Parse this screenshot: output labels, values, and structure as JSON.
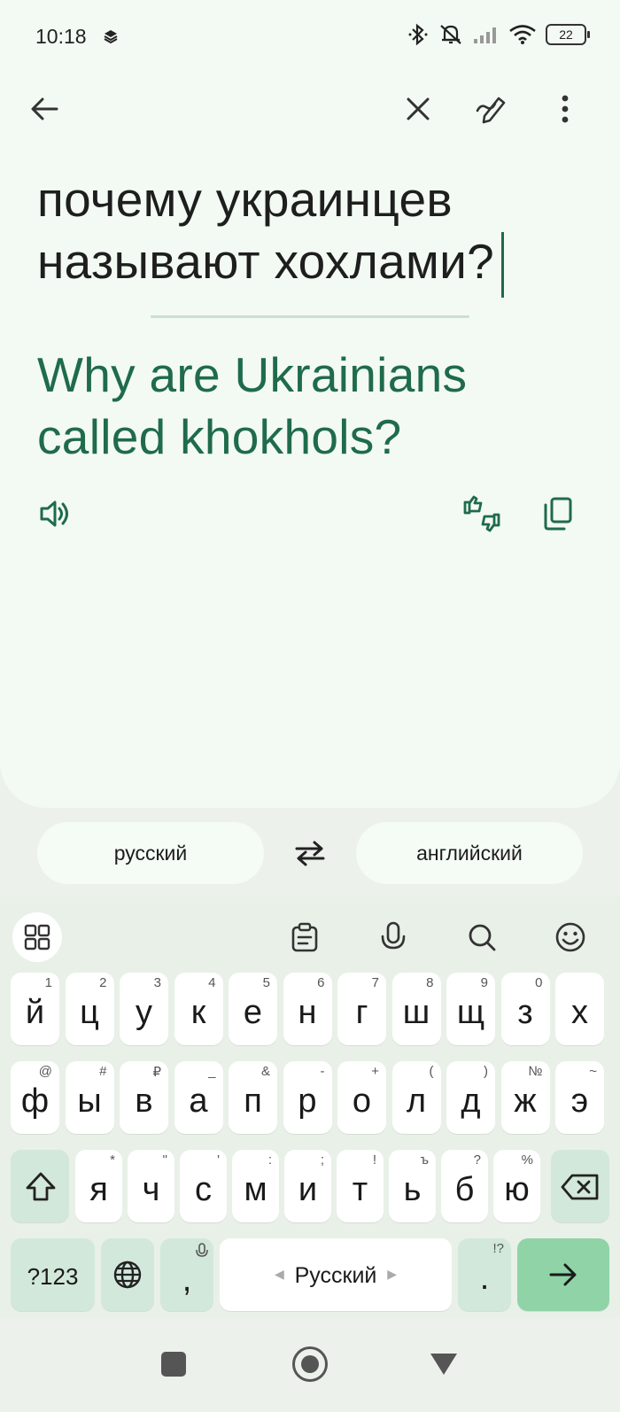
{
  "status_bar": {
    "time": "10:18",
    "battery": "22"
  },
  "source_text": "почему украинцев называют хохлами?",
  "translated_text": "Why are Ukrainians called khokhols?",
  "languages": {
    "source": "русский",
    "target": "английский"
  },
  "keyboard": {
    "row1": [
      {
        "hint": "1",
        "key": "й"
      },
      {
        "hint": "2",
        "key": "ц"
      },
      {
        "hint": "3",
        "key": "у"
      },
      {
        "hint": "4",
        "key": "к"
      },
      {
        "hint": "5",
        "key": "е"
      },
      {
        "hint": "6",
        "key": "н"
      },
      {
        "hint": "7",
        "key": "г"
      },
      {
        "hint": "8",
        "key": "ш"
      },
      {
        "hint": "9",
        "key": "щ"
      },
      {
        "hint": "0",
        "key": "з"
      },
      {
        "hint": "",
        "key": "х"
      }
    ],
    "row2": [
      {
        "hint": "@",
        "key": "ф"
      },
      {
        "hint": "#",
        "key": "ы"
      },
      {
        "hint": "₽",
        "key": "в"
      },
      {
        "hint": "_",
        "key": "а"
      },
      {
        "hint": "&",
        "key": "п"
      },
      {
        "hint": "-",
        "key": "р"
      },
      {
        "hint": "+",
        "key": "о"
      },
      {
        "hint": "(",
        "key": "л"
      },
      {
        "hint": ")",
        "key": "д"
      },
      {
        "hint": "№",
        "key": "ж"
      },
      {
        "hint": "~",
        "key": "э"
      }
    ],
    "row3": [
      {
        "hint": "*",
        "key": "я"
      },
      {
        "hint": "\"",
        "key": "ч"
      },
      {
        "hint": "'",
        "key": "с"
      },
      {
        "hint": ":",
        "key": "м"
      },
      {
        "hint": ";",
        "key": "и"
      },
      {
        "hint": "!",
        "key": "т"
      },
      {
        "hint": "ъ",
        "key": "ь"
      },
      {
        "hint": "?",
        "key": "б"
      },
      {
        "hint": "%",
        "key": "ю"
      }
    ],
    "symbols_label": "?123",
    "comma_label": ",",
    "space_label": "Русский",
    "period_label": ".",
    "period_hint": "!?"
  }
}
